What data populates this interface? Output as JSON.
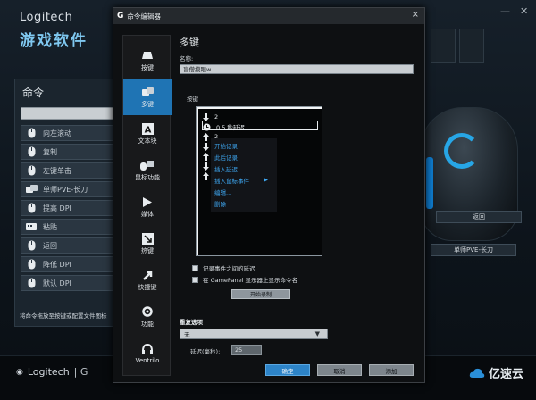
{
  "background": {
    "brand": "Logitech",
    "app_title": "游戏软件",
    "commands_title": "命令",
    "commands": [
      {
        "label": "向左滚动",
        "icon": "mouse-icon"
      },
      {
        "label": "复制",
        "icon": "mouse-icon"
      },
      {
        "label": "左键单击",
        "icon": "mouse-icon"
      },
      {
        "label": "单师PVE-长刀",
        "icon": "multikey-icon"
      },
      {
        "label": "提高 DPI",
        "icon": "mouse-icon"
      },
      {
        "label": "粘贴",
        "icon": "keyboard-icon"
      },
      {
        "label": "返回",
        "icon": "mouse-icon"
      },
      {
        "label": "降低 DPI",
        "icon": "mouse-icon"
      },
      {
        "label": "默认 DPI",
        "icon": "mouse-icon"
      }
    ],
    "hint": "将命令拖放至按键或配置文件图标",
    "right_labels": {
      "return": "返回",
      "assigned": "单师PVE-长刀"
    },
    "footer_logo": "Logitech",
    "watermark": "亿速云"
  },
  "dialog": {
    "title": "命令编辑器",
    "close": "×",
    "sidebar": [
      {
        "label": "按键",
        "icon": "key-icon",
        "active": false
      },
      {
        "label": "多键",
        "icon": "multikey-icon",
        "active": true
      },
      {
        "label": "文本块",
        "icon": "text-block-icon",
        "active": false
      },
      {
        "label": "鼠标功能",
        "icon": "mouse-function-icon",
        "active": false
      },
      {
        "label": "媒体",
        "icon": "media-icon",
        "active": false
      },
      {
        "label": "热键",
        "icon": "hotkey-icon",
        "active": false
      },
      {
        "label": "快捷键",
        "icon": "shortcut-icon",
        "active": false
      },
      {
        "label": "功能",
        "icon": "function-icon",
        "active": false
      },
      {
        "label": "Ventrilo",
        "icon": "headset-icon",
        "active": false
      }
    ],
    "section_title": "多键",
    "name_label": "名称:",
    "name_value": "盲僧摸眼w",
    "keys_label": "按键",
    "key_rows": [
      {
        "icon": "arrow-down-icon",
        "text": "2"
      },
      {
        "icon": "clock-icon",
        "text": "0.5 秒延迟"
      },
      {
        "icon": "arrow-up-icon",
        "text": "2"
      },
      {
        "icon": "arrow-down-icon",
        "text": ""
      },
      {
        "icon": "arrow-up-icon",
        "text": ""
      },
      {
        "icon": "arrow-down-icon",
        "text": ""
      },
      {
        "icon": "arrow-up-icon",
        "text": ""
      }
    ],
    "context_menu": [
      "开始记录",
      "此后记录",
      "插入延迟",
      "插入鼠标事件",
      "编辑...",
      "删除"
    ],
    "record_delay_label": "记录事件之间的延迟",
    "show_in_gamepanel_label": "在 GamePanel 显示器上显示命令名",
    "start_record_btn": "开始录制",
    "repeat_label": "重复选项",
    "repeat_value": "无",
    "delay_label": "延迟(毫秒):",
    "delay_value": "25",
    "ok_btn": "确定",
    "cancel_btn": "取消",
    "add_btn": "添加"
  },
  "colors": {
    "accent": "#1f74b4",
    "link": "#3da6f0",
    "brand_blue": "#27a6e6"
  }
}
